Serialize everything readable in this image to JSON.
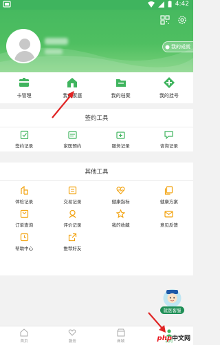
{
  "status_bar": {
    "time": "4:42"
  },
  "header": {
    "vip_label": "我的成就"
  },
  "quick_actions": [
    {
      "icon": "card-icon",
      "label": "卡管理"
    },
    {
      "icon": "home-icon",
      "label": "我的家庭"
    },
    {
      "icon": "folder-icon",
      "label": "我的档案"
    },
    {
      "icon": "plus-diamond-icon",
      "label": "我的挂号"
    }
  ],
  "sign_tools": {
    "title": "签约工具",
    "items": [
      {
        "icon": "clipboard-check-icon",
        "label": "签约记录"
      },
      {
        "icon": "calendar-icon",
        "label": "家医预约"
      },
      {
        "icon": "medkit-icon",
        "label": "服务记录"
      },
      {
        "icon": "chat-icon",
        "label": "咨询记录"
      }
    ]
  },
  "other_tools": {
    "title": "其他工具",
    "items": [
      {
        "icon": "building-icon",
        "label": "体检记录"
      },
      {
        "icon": "exchange-icon",
        "label": "交易记录"
      },
      {
        "icon": "heart-pulse-icon",
        "label": "健康指标"
      },
      {
        "icon": "copy-icon",
        "label": "健康方案"
      },
      {
        "icon": "order-icon",
        "label": "订单查询"
      },
      {
        "icon": "doctor-icon",
        "label": "评价记录"
      },
      {
        "icon": "star-icon",
        "label": "我的收藏"
      },
      {
        "icon": "mail-icon",
        "label": "意见反馈"
      },
      {
        "icon": "clock-icon",
        "label": "帮助中心"
      },
      {
        "icon": "share-icon",
        "label": "推荐好友"
      }
    ]
  },
  "floating_assistant": {
    "label": "就医客服"
  },
  "tabbar": [
    {
      "icon": "home-tab-icon",
      "label": "首页"
    },
    {
      "icon": "hand-heart-tab-icon",
      "label": "服务"
    },
    {
      "icon": "store-tab-icon",
      "label": "商城"
    },
    {
      "icon": "person-tab-icon",
      "label": "我的"
    }
  ],
  "watermark": {
    "brand": "php",
    "suffix": "中文网"
  },
  "colors": {
    "primary": "#3fb45e",
    "icon_orange": "#f2a20e",
    "arrow": "#e02424"
  }
}
